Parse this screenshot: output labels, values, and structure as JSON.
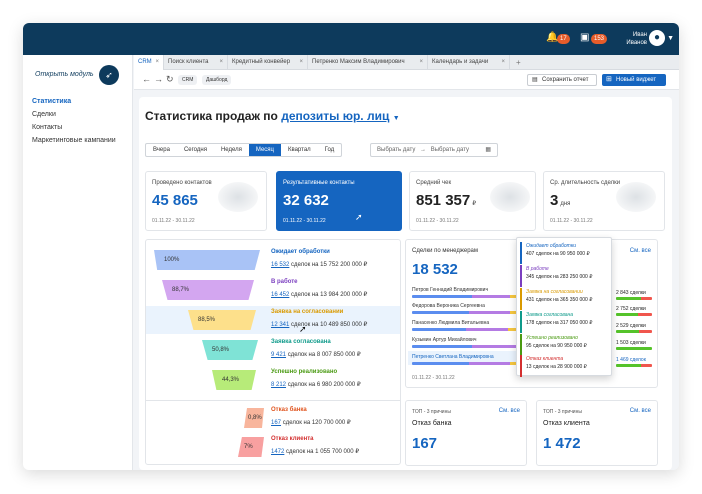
{
  "topbar": {
    "notif_count": "17",
    "calendar_count": "153",
    "user_first": "Иван",
    "user_last": "Иванов"
  },
  "sidebar": {
    "module_label": "Открыть модуль",
    "items": [
      "Статистика",
      "Сделки",
      "Контакты",
      "Маркетинговые кампании"
    ]
  },
  "tabs": [
    "CRM",
    "Поиск клиента",
    "Кредитный конвейер",
    "Петренко Максим Владимирович",
    "Календарь и задачи"
  ],
  "toolbar": {
    "crumbs": [
      "CRM",
      "Дашборд"
    ],
    "save": "Сохранить отчет",
    "new_widget": "Новый виджет"
  },
  "page": {
    "title": "Статистика продаж по",
    "title_link": "депозиты юр. лиц"
  },
  "periods": [
    "Вчера",
    "Сегодня",
    "Неделя",
    "Месяц",
    "Квартал",
    "Год"
  ],
  "active_period": "Месяц",
  "daterange": {
    "from": "Выбрать дату",
    "arrow": "→",
    "to": "Выбрать дату"
  },
  "cards": [
    {
      "label": "Проведено контактов",
      "value": "45 865",
      "unit": "",
      "dates": "01.11.22 - 30.11.22"
    },
    {
      "label": "Результативные контакты",
      "value": "32 632",
      "unit": "",
      "dates": "01.11.22 - 30.11.22"
    },
    {
      "label": "Средний чек",
      "value": "851 357",
      "unit": "₽",
      "dates": "01.11.22 - 30.11.22"
    },
    {
      "label": "Ср. длительность сделки",
      "value": "3",
      "unit": "дня",
      "dates": "01.11.22 - 30.11.22"
    }
  ],
  "funnel": [
    {
      "pct": "100%",
      "name": "Ожидает обработки",
      "count": "16 532",
      "rest": "сделок на 15 752 200 000 ₽",
      "color": "#a9c3f6",
      "name_color": "#1565c0"
    },
    {
      "pct": "88,7%",
      "name": "В работе",
      "count": "16 452",
      "rest": "сделок на 13 984 200 000 ₽",
      "color": "#d3a6f0",
      "name_color": "#7b3fbf"
    },
    {
      "pct": "88,5%",
      "name": "Заявка на согласовании",
      "count": "12 341",
      "rest": "сделок на 10 489 850 000 ₽",
      "color": "#fde08b",
      "name_color": "#d99a00"
    },
    {
      "pct": "50,8%",
      "name": "Заявка согласована",
      "count": "9 421",
      "rest": "сделок на 8 007 850 000 ₽",
      "color": "#7fe3d6",
      "name_color": "#0e9a8a"
    },
    {
      "pct": "44,3%",
      "name": "Успешно реализовано",
      "count": "8 212",
      "rest": "сделок на 6 980 200 000 ₽",
      "color": "#b7eb79",
      "name_color": "#4a9a12"
    },
    {
      "pct": "0,8%",
      "name": "Отказ банка",
      "count": "167",
      "rest": "сделок на 120 700 000 ₽",
      "color": "#f8b59c",
      "name_color": "#e0531d"
    },
    {
      "pct": "7%",
      "name": "Отказ клиента",
      "count": "1472",
      "rest": "сделок на 1 055 700 000 ₽",
      "color": "#f8a0a0",
      "name_color": "#d32f2f"
    }
  ],
  "managers": {
    "title": "Сделки по менеджерам",
    "total": "18 532",
    "see_all": "См. все",
    "dates": "01.11.22 - 30.11.22",
    "rows": [
      {
        "name": "Петров Геннадий Владимирович",
        "right": "2 843 сделки"
      },
      {
        "name": "Федорова Вероника Сергеевна",
        "right": "2 752 сделки"
      },
      {
        "name": "Панасенко Людмила Витальевна",
        "right": "2 529 сделки"
      },
      {
        "name": "Кузьмин Артур Михайлович",
        "right": "1 503 сделки"
      },
      {
        "name": "Петренко Светлана Владимировна",
        "right": "1 469 сделок"
      }
    ]
  },
  "popup": [
    {
      "title": "Ожидает обработки",
      "text": "407 сделок на 90 950 000 ₽",
      "color": "#1565c0"
    },
    {
      "title": "В работе",
      "text": "345 сделок на 283 250 000 ₽",
      "color": "#7b3fbf"
    },
    {
      "title": "Заявка на согласовании",
      "text": "431 сделок на 365 350 000 ₽",
      "color": "#d99a00"
    },
    {
      "title": "Заявка согласована",
      "text": "178 сделок на 317 050 000 ₽",
      "color": "#0e9a8a"
    },
    {
      "title": "Успешно реализовано",
      "text": "95 сделок на 90 950 000 ₽",
      "color": "#4a9a12"
    },
    {
      "title": "Отказ клиента",
      "text": "13 сделок на 28 900 000 ₽",
      "color": "#d32f2f"
    }
  ],
  "top_reasons": [
    {
      "small": "ТОП - 3 причины",
      "name": "Отказ банка",
      "value": "167",
      "see_all": "См. все"
    },
    {
      "small": "ТОП - 3 причины",
      "name": "Отказ клиента",
      "value": "1 472",
      "see_all": "См. все"
    }
  ]
}
